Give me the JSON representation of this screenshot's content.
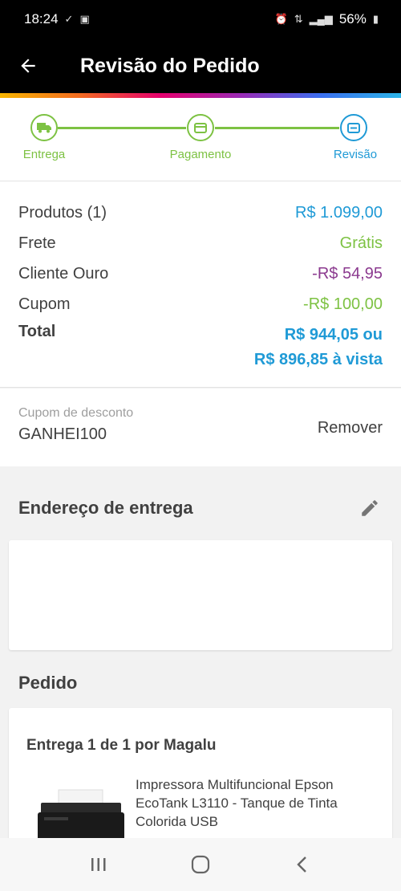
{
  "status_bar": {
    "time": "18:24",
    "battery": "56%"
  },
  "app_bar": {
    "title": "Revisão do Pedido",
    "back_icon": "arrow-left-icon"
  },
  "stepper": {
    "steps": [
      {
        "label": "Entrega",
        "icon": "truck-icon",
        "state": "done"
      },
      {
        "label": "Pagamento",
        "icon": "card-icon",
        "state": "done"
      },
      {
        "label": "Revisão",
        "icon": "review-icon",
        "state": "current"
      }
    ]
  },
  "summary": {
    "products_label": "Produtos (1)",
    "products_value": "R$ 1.099,00",
    "shipping_label": "Frete",
    "shipping_value": "Grátis",
    "gold_label": "Cliente Ouro",
    "gold_value": "-R$ 54,95",
    "coupon_label": "Cupom",
    "coupon_value": "-R$ 100,00",
    "total_label": "Total",
    "total_value_line1": "R$ 944,05 ou",
    "total_value_line2": "R$ 896,85 à vista"
  },
  "coupon": {
    "label": "Cupom de desconto",
    "code": "GANHEI100",
    "remove_label": "Remover"
  },
  "address": {
    "title": "Endereço de entrega",
    "edit_icon": "pencil-icon"
  },
  "order": {
    "title": "Pedido",
    "delivery_text": "Entrega 1 de 1 por Magalu",
    "product_name": "Impressora Multifuncional Epson EcoTank L3110 - Tanque de Tinta Colorida USB"
  },
  "colors": {
    "accent_green": "#7dc243",
    "accent_blue": "#1f9ad6",
    "purple": "#8b3a8f"
  }
}
